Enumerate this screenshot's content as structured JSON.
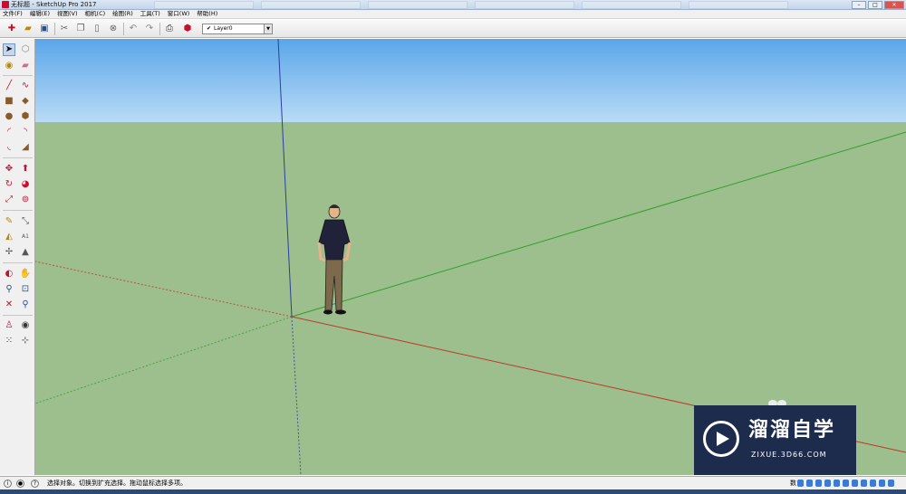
{
  "window": {
    "title": "无标题 - SketchUp Pro 2017"
  },
  "menu": {
    "items": [
      "文件(F)",
      "编辑(E)",
      "视图(V)",
      "相机(C)",
      "绘图(R)",
      "工具(T)",
      "窗口(W)",
      "帮助(H)"
    ]
  },
  "toolbar": {
    "layer_value": "Layer0",
    "layer_check": "✔"
  },
  "statusbar": {
    "hint": "选择对象。切换到扩充选择。拖动鼠标选择多项。",
    "measure_label": "数"
  },
  "watermark": {
    "brand": "溜溜自学",
    "url": "ZIXUE.3D66.COM"
  },
  "colors": {
    "sky_top": "#5aa6ea",
    "ground": "#9dbe8d",
    "axis_red": "#c0392b",
    "axis_green": "#2ea02e",
    "axis_blue": "#2a3fa0"
  }
}
